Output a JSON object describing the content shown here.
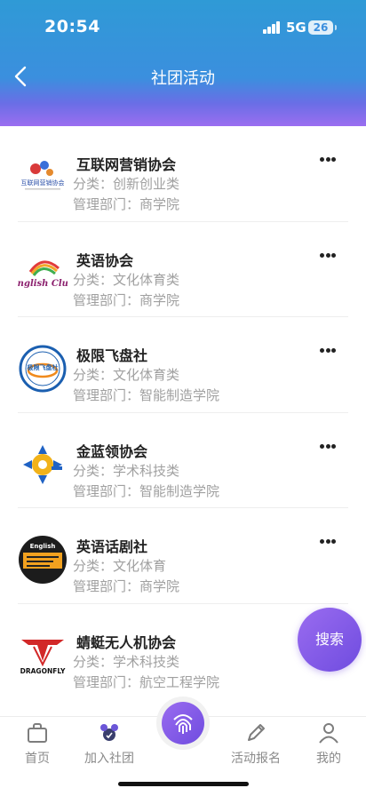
{
  "status_bar": {
    "time": "20:54",
    "network": "5G",
    "battery": "26"
  },
  "header": {
    "title": "社团活动"
  },
  "clubs": [
    {
      "name": "互联网营销协会",
      "category": "分类：创新创业类",
      "department": "管理部门：商学院",
      "logo_text": "互联网营销协会"
    },
    {
      "name": "英语协会",
      "category": "分类：文化体育类",
      "department": "管理部门：商学院",
      "logo_text": "English Club"
    },
    {
      "name": "极限飞盘社",
      "category": "分类：文化体育类",
      "department": "管理部门：智能制造学院",
      "logo_text": "极限飞盘社"
    },
    {
      "name": "金蓝领协会",
      "category": "分类：学术科技类",
      "department": "管理部门：智能制造学院"
    },
    {
      "name": "英语话剧社",
      "category": "分类：文化体育",
      "department": "管理部门：商学院",
      "logo_text": "English"
    },
    {
      "name": "蜻蜓无人机协会",
      "category": "分类：学术科技类",
      "department": "管理部门：航空工程学院",
      "logo_text": "DRAGONFLY"
    }
  ],
  "fab": {
    "label": "搜索"
  },
  "tabbar": {
    "items": [
      {
        "label": "首页",
        "icon": "bag-icon"
      },
      {
        "label": "加入社团",
        "icon": "group-icon"
      },
      {
        "label": "",
        "icon": "fingerprint-icon"
      },
      {
        "label": "活动报名",
        "icon": "pencil-icon"
      },
      {
        "label": "我的",
        "icon": "user-icon"
      }
    ]
  },
  "colors": {
    "header_top": "#2f9ad6",
    "header_bottom": "#9b6ef0",
    "accent": "#7a55e6",
    "muted_text": "#a0a0a0"
  }
}
